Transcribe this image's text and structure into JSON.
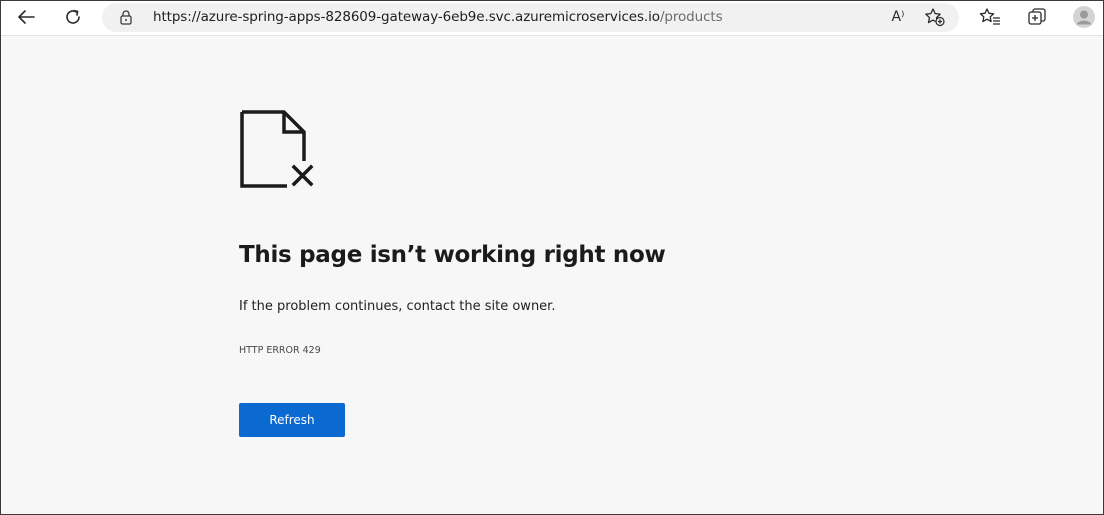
{
  "browser": {
    "url_host": "https://azure-spring-apps-828609-gateway-6eb9e.svc.azuremicroservices.io",
    "url_path": "/products",
    "read_aloud_label": "A⁾",
    "icons": {
      "back": "back-arrow-icon",
      "reload": "reload-icon",
      "lock": "lock-icon",
      "read_aloud": "read-aloud-icon",
      "add_favorite": "add-favorite-star-icon",
      "favorites": "favorites-icon",
      "collections": "collections-icon",
      "profile": "profile-avatar-icon"
    }
  },
  "error_page": {
    "icon": "broken-file-icon",
    "title": "This page isn’t working right now",
    "description": "If the problem continues, contact the site owner.",
    "error_code": "HTTP ERROR 429",
    "refresh_label": "Refresh"
  },
  "colors": {
    "accent": "#0a6ad1",
    "page_background": "#f7f7f7",
    "toolbar_background": "#ffffff"
  }
}
